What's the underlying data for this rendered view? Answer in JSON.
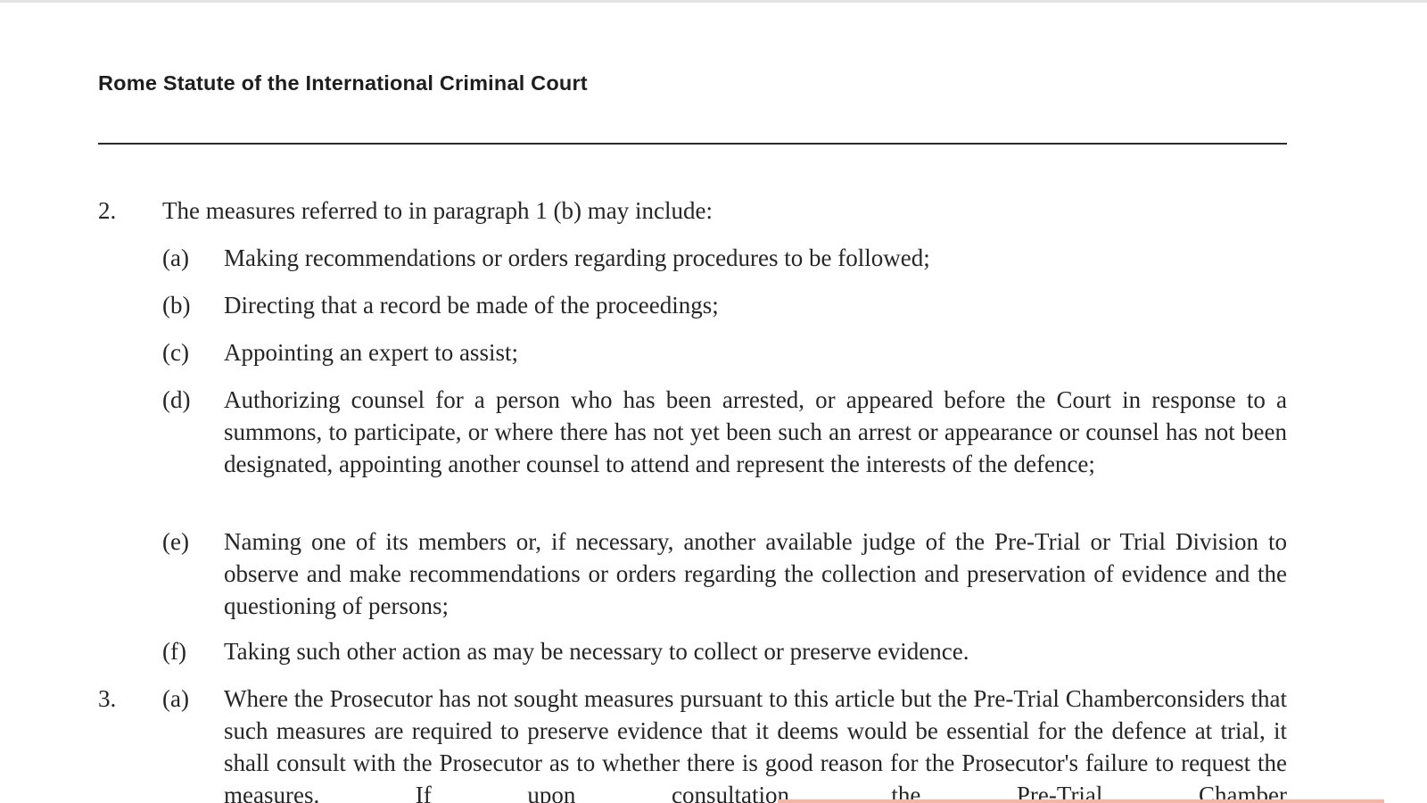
{
  "document": {
    "running_header": "Rome Statute of the International Criminal Court"
  },
  "paragraph_2": {
    "number": "2.",
    "intro": "The measures referred to in paragraph 1 (b) may include:",
    "items": [
      {
        "label": "(a)",
        "text": "Making recommendations or orders regarding procedures to be followed;"
      },
      {
        "label": "(b)",
        "text": "Directing that a record be made of the proceedings;"
      },
      {
        "label": "(c)",
        "text": "Appointing an expert to assist;"
      },
      {
        "label": "(d)",
        "text": "Authorizing counsel for a person who has been arrested, or appeared before the Court in response to a summons, to participate, or where there has not yet been such an arrest or appearance or counsel has not been designated, appointing another counsel to attend and represent the interests of the defence;"
      },
      {
        "label": "(e)",
        "text": "Naming one of its members or, if necessary, another available judge of the Pre-Trial or Trial Division to observe and make recommendations or orders regarding the collection and preservation of evidence and the questioning of persons;"
      },
      {
        "label": "(f)",
        "text": "Taking such other action as may be necessary to collect or preserve evidence."
      }
    ]
  },
  "paragraph_3": {
    "number": "3.",
    "items": [
      {
        "label": "(a)",
        "text": "Where the Prosecutor has not sought measures pursuant to this article but the Pre-Trial Chamberconsiders that such measures are required to preserve evidence that it deems would be essential for the defence at trial, it shall consult with the Prosecutor as to whether there is good reason for the Prosecutor's failure to request the measures. If upon consultation, the Pre-Trial Chamber"
      }
    ]
  },
  "colors": {
    "text": "#262626",
    "rule": "#2a2a2a",
    "highlight": "#f2b7a6"
  }
}
